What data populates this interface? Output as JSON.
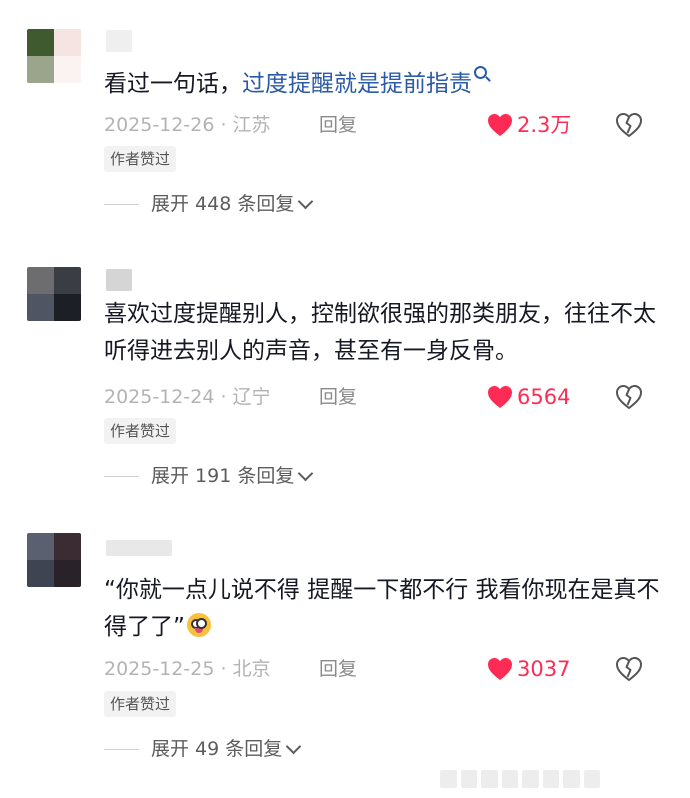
{
  "comments": [
    {
      "text_plain": "看过一句话，",
      "text_link": "过度提醒就是提前指责",
      "date": "2025-12-26 · 江苏",
      "reply_label": "回复",
      "like_count": "2.3万",
      "author_liked": "作者赞过",
      "expand_label": "展开 448 条回复"
    },
    {
      "text_plain": "喜欢过度提醒别人，控制欲很强的那类朋友，往往不太听得进去别人的声音，甚至有一身反骨。",
      "date": "2025-12-24 · 辽宁",
      "reply_label": "回复",
      "like_count": "6564",
      "author_liked": "作者赞过",
      "expand_label": "展开 191 条回复"
    },
    {
      "text_plain": "“你就一点儿说不得 提醒一下都不行 我看你现在是真不得了了”",
      "date": "2025-12-25 · 北京",
      "reply_label": "回复",
      "like_count": "3037",
      "author_liked": "作者赞过",
      "expand_label": "展开 49 条回复"
    }
  ],
  "icons": {
    "like": "heart-icon",
    "dislike": "broken-heart-icon",
    "search": "search-icon",
    "expand": "chevron-down-icon"
  },
  "colors": {
    "like": "#fe2c55",
    "link": "#2b5aa7",
    "text": "#161823",
    "meta": "#b3b3b3"
  }
}
